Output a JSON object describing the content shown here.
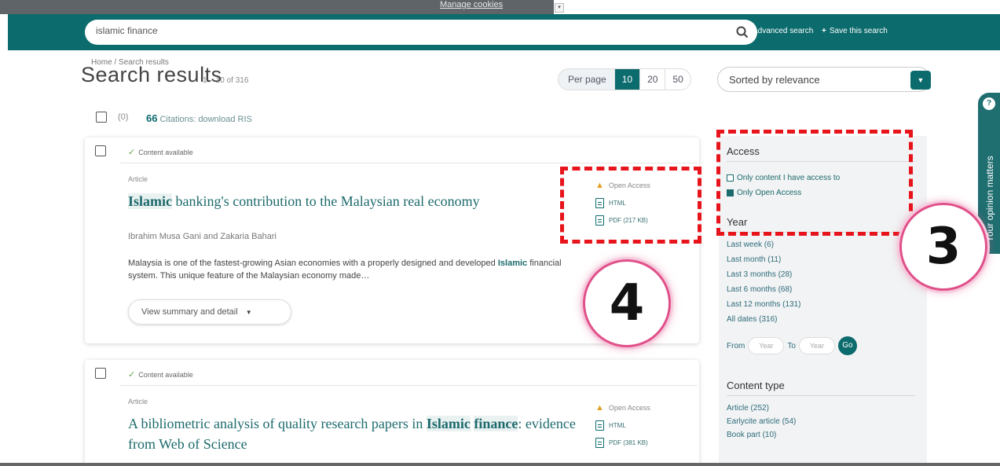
{
  "cookie": {
    "link": "Manage cookies",
    "caret": "▾"
  },
  "search": {
    "value": "islamic finance",
    "advanced": "Advanced search",
    "save": "Save this search",
    "plus": "+"
  },
  "breadcrumb": "Home / Search results",
  "title": "Search results",
  "count": "1 – 10 of 316",
  "per_page": {
    "label": "Per page",
    "options": [
      "10",
      "20",
      "50"
    ],
    "selected": "10"
  },
  "sort": {
    "label": "Sorted by relevance",
    "caret": "▼"
  },
  "select_all": {
    "count": "(0)",
    "citations": "Citations: download RIS",
    "quote_mark": "66"
  },
  "results": [
    {
      "availability": "Content available",
      "type": "Article",
      "title_hl": "Islamic",
      "title_rest": " banking's contribution to the Malaysian real economy",
      "authors": "Ibrahim Musa Gani and Zakaria Bahari",
      "abstract_pre": "Malaysia is one of the fastest-growing Asian economies with a properly designed and developed ",
      "abstract_hl": "Islamic",
      "abstract_post": " financial system. This unique feature of the Malaysian economy made…",
      "view_btn": "View summary and detail",
      "access": "Open Access",
      "html": "HTML",
      "pdf": "PDF (217 KB)"
    },
    {
      "availability": "Content available",
      "type": "Article",
      "title_pre": "A bibliometric analysis of quality research papers in ",
      "title_hl1": "Islamic",
      "title_hl2": "finance",
      "title_post": ": evidence from Web of Science",
      "access": "Open Access",
      "html": "HTML",
      "pdf": "PDF (381 KB)"
    }
  ],
  "sidebar": {
    "access_heading": "Access",
    "access_opt1": "Only content I have access to",
    "access_opt2": "Only Open Access",
    "year_heading": "Year",
    "years": [
      "Last week (6)",
      "Last month (11)",
      "Last 3 months (28)",
      "Last 6 months (68)",
      "Last 12 months (131)",
      "All dates (316)"
    ],
    "from": "From",
    "to": "To",
    "year_ph": "Year",
    "go": "Go",
    "content_heading": "Content type",
    "content_types": [
      "Article (252)",
      "Earlycite article (54)",
      "Book part (10)"
    ]
  },
  "opinion": {
    "text": "Your opinion matters",
    "icon": "chat-bubble-icon"
  },
  "annotations": {
    "label3": "3",
    "label4": "4"
  },
  "colors": {
    "teal": "#0c6b6d",
    "annotation_red": "#e8141c",
    "callout_pink": "#e0508a"
  }
}
